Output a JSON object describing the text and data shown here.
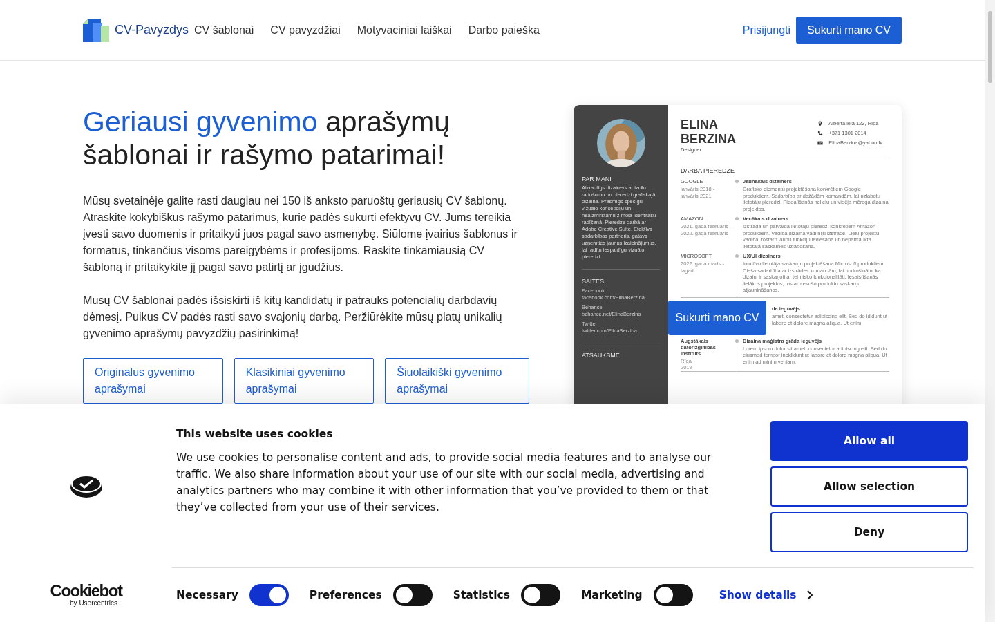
{
  "nav": {
    "logo_text": "CV-Pavyzdys",
    "links": [
      "CV šablonai",
      "CV pavyzdžiai",
      "Motyvaciniai laiškai",
      "Darbo paieška"
    ],
    "login": "Prisijungti",
    "cta": "Sukurti mano CV"
  },
  "hero": {
    "title_highlight": "Geriausi gyvenimo",
    "title_rest": "aprašymų šablonai ir rašymo patarimai!",
    "paragraphs": [
      "Mūsų svetainėje galite rasti daugiau nei 150 iš anksto paruoštų geriausių CV šablonų. Atraskite kokybiškus rašymo patarimus, kurie padės sukurti efektyvų CV. Jums tereikia įvesti savo duomenis ir pritaikyti juos pagal savo asmenybę. Siūlome įvairius šablonus ir formatus, tinkančius visoms pareigybėms ir profesijoms. Raskite tinkamiausią CV šabloną ir pritaikykite jį pagal savo patirtį ar įgūdžius.",
      "Mūsų CV šablonai padės išsiskirti iš kitų kandidatų ir patrauks potencialių darbdavių dėmesį. Puikus CV padės rasti savo svajonių darbą. Peržiūrėkite mūsų platų unikalių gyvenimo aprašymų pavyzdžių pasirinkimą!"
    ],
    "buttons": [
      "Originalūs gyvenimo aprašymai",
      "Klasikiniai gyvenimo aprašymai",
      "Šiuolaikiški gyvenimo aprašymai"
    ]
  },
  "cv_preview": {
    "name_lines": [
      "ELINA",
      "BERZINA"
    ],
    "role": "Designer",
    "contacts": [
      {
        "kind": "location",
        "text": "Alberta iela 123, Rīga"
      },
      {
        "kind": "phone",
        "text": "+371 1301 2014"
      },
      {
        "kind": "email",
        "text": "ElinaBerzina@yahoo.lv"
      }
    ],
    "about": {
      "title": "PAR MANI",
      "text": "Aizrautīgs dizainers ar izcilu radošumu un pieredzi grafiskajā dizainā. Prasmīgs spēcīgu vizuālo koncepciju un neaizmirstamu zīmola identitāšu radīšanā. Pieredze darbā ar Adobe Creative Suite. Efektīvs sadarbības partneris, gatavs uzņemties jaunus izaicinājumus, lai radītu iespaidīgu vizuālo pieredzi."
    },
    "links": {
      "title": "SAITES",
      "items": [
        {
          "label": "Facebook:",
          "url": "facebook.com/ElinaBerzina"
        },
        {
          "label": "Behance",
          "url": "behance.net/ElinaBerzina"
        },
        {
          "label": "Twitter",
          "url": "twitter.com/ElinaBerzina"
        }
      ]
    },
    "reference": {
      "title": "ATSAUKSME"
    },
    "experience": {
      "title": "DARBA PIEREDZE",
      "items": [
        {
          "company": "GOOGLE",
          "dates": "janvāris 2018 - janvāris 2021",
          "role": "Jaunākais dizainers",
          "description": "Grafisko elementu projektēšana konkrētiem Google produktiem. Sadarbība ar dažādām komandām, lai uzlabotu lietotāju pieredzi. Piedalīšanās nelielu un vidēja mēroga dizaina projektos."
        },
        {
          "company": "AMAZON",
          "dates": "2021. gada februāris - 2022. gada februāris",
          "role": "Vecākais dizainers",
          "description": "Izstrādā un pārvalda lietotāju pieredzi konkrētiem Amazon produktiem. Vadība dizaina vadlīniju izstrādē. Lielu projektu vadība, tostarp jaunu funkciju ieviešana un nepārtraukta lietotāja saskarnes uzlabošana."
        },
        {
          "company": "MICROSOFT",
          "dates": "2022. gada marts - tagad",
          "role": "UX/UI dizainers",
          "description": "Intuitīvu lietotāja saskarņu projektēšana Microsoft produktiem. Cieša sadarbība ar izstrādes komandām, lai nodrošinātu, ka dizaini ir saskaņoti ar tehnisko funkcionalitāti. Iesaistīšanās lielākos projektos, tostarp esošo produktu saskarņu atjaunināšanos."
        }
      ]
    },
    "education_partial": {
      "role": "da ieguvējs",
      "description": "amet, consectetur adipiscing elit. Sed do ididunt ut labore et dolore magna aliqua. Ut enim"
    },
    "education": [
      {
        "school": "Augstākais datorizglītības institūts",
        "place": "Rīga",
        "year": "2019",
        "role": "Dizaina maģistra grāda ieguvējs",
        "description": "Lorem ipsum dolor sit amet, consectetur adipiscing elit. Sed do eiusmod tempor incididunt ut labore et dolore magna aliqua. Ut enim ad minim veniam."
      }
    ],
    "overlay_button": "Sukurti mano CV"
  },
  "cookie_banner": {
    "title": "This website uses cookies",
    "text": "We use cookies to personalise content and ads, to provide social media features and to analyse our traffic. We also share information about your use of our site with our social media, advertising and analytics partners who may combine it with other information that you’ve provided to them or that they’ve collected from your use of their services.",
    "buttons": [
      {
        "label": "Allow all",
        "kind": "primary"
      },
      {
        "label": "Allow selection",
        "kind": "outline"
      },
      {
        "label": "Deny",
        "kind": "outline"
      }
    ],
    "toggles": [
      {
        "label": "Necessary",
        "on": true
      },
      {
        "label": "Preferences",
        "on": false
      },
      {
        "label": "Statistics",
        "on": false
      },
      {
        "label": "Marketing",
        "on": false
      }
    ],
    "show_details": "Show details",
    "brand": "Cookiebot",
    "brand_sub": "by Usercentrics"
  }
}
